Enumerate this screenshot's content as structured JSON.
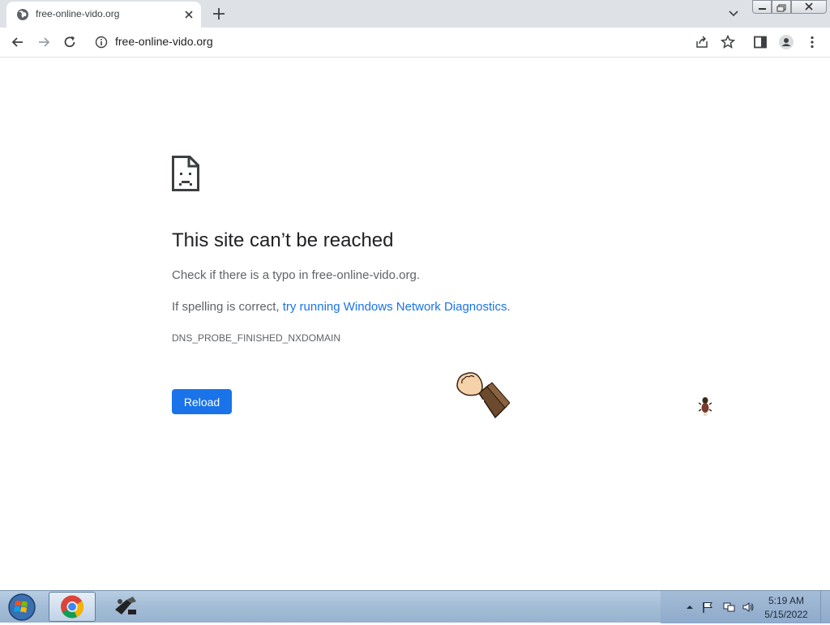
{
  "browser": {
    "tab": {
      "title": "free-online-vido.org",
      "favicon": "globe-icon"
    },
    "toolbar": {
      "url": "free-online-vido.org"
    }
  },
  "page": {
    "icon": "sad-page-icon",
    "title": "This site can’t be reached",
    "line1": "Check if there is a typo in free-online-vido.org.",
    "line2_prefix": "If spelling is correct, ",
    "line2_link": "try running Windows Network Diagnostics",
    "line2_suffix": ".",
    "error_code": "DNS_PROBE_FINISHED_NXDOMAIN",
    "reload_label": "Reload",
    "accent_color": "#1a73e8"
  },
  "taskbar": {
    "clock_time": "5:19 AM",
    "clock_date": "5/15/2022"
  }
}
